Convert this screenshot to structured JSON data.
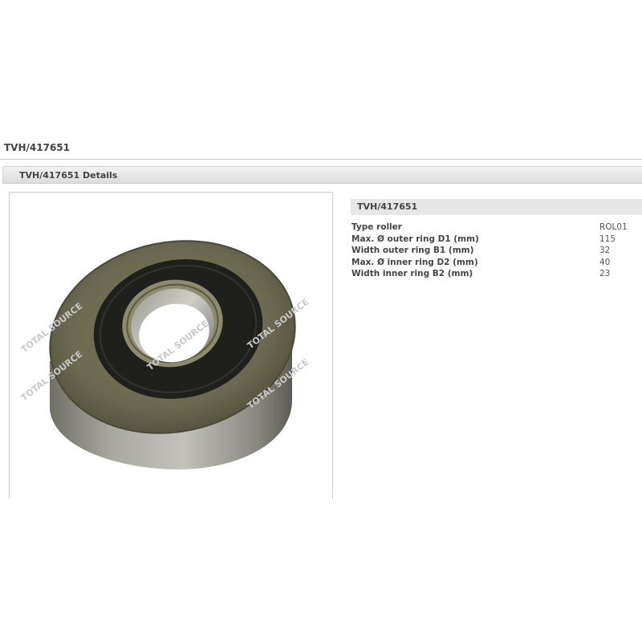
{
  "page": {
    "title": "TVH/417651"
  },
  "details_section": {
    "label": "TVH/417651 Details"
  },
  "product_image": {
    "watermark_text": "TOTAL SOURCE"
  },
  "specs": {
    "header": "TVH/417651",
    "rows": [
      {
        "label": "Type roller",
        "value": "ROL01"
      },
      {
        "label": "Max. Ø outer ring D1 (mm)",
        "value": "115"
      },
      {
        "label": "Width outer ring B1 (mm)",
        "value": "32"
      },
      {
        "label": "Max. Ø inner ring D2 (mm)",
        "value": "40"
      },
      {
        "label": "Width inner ring B2 (mm)",
        "value": "23"
      }
    ]
  }
}
